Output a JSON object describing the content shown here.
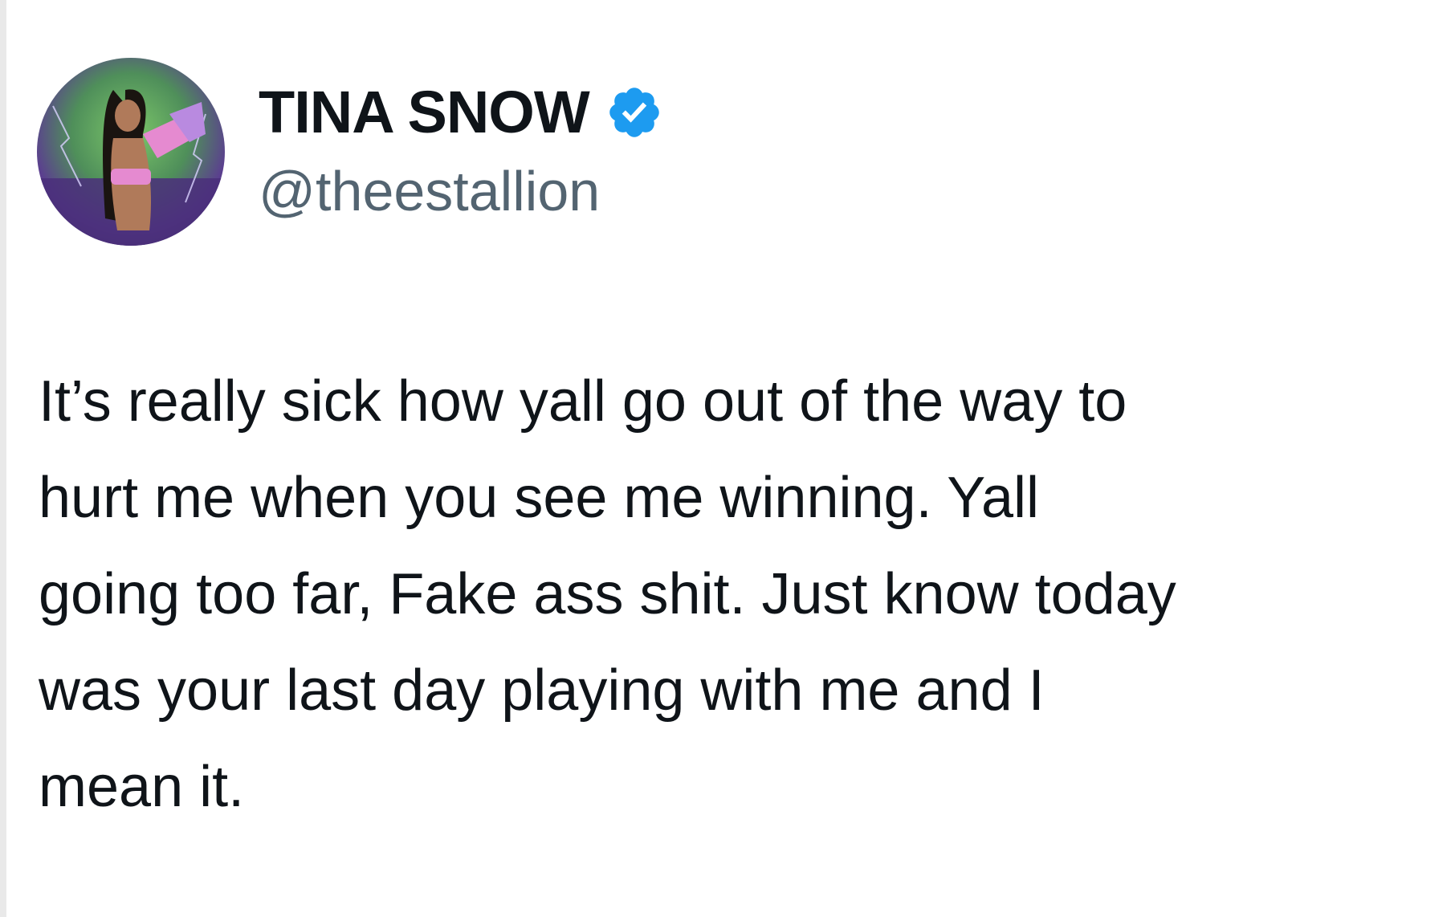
{
  "tweet": {
    "author": {
      "display_name": "TINA SNOW",
      "handle": "@theestallion",
      "verified": true,
      "avatar_icon": "profile-photo"
    },
    "text_lines": [
      "It’s really sick how yall go out of the way to",
      "hurt me when you see me winning. Yall",
      "going too far, Fake ass shit. Just know today",
      "was your last day playing with me and I",
      "mean it."
    ]
  },
  "colors": {
    "verified_badge": "#1d9bf0",
    "handle_text": "#536471",
    "body_text": "#0f1419"
  }
}
